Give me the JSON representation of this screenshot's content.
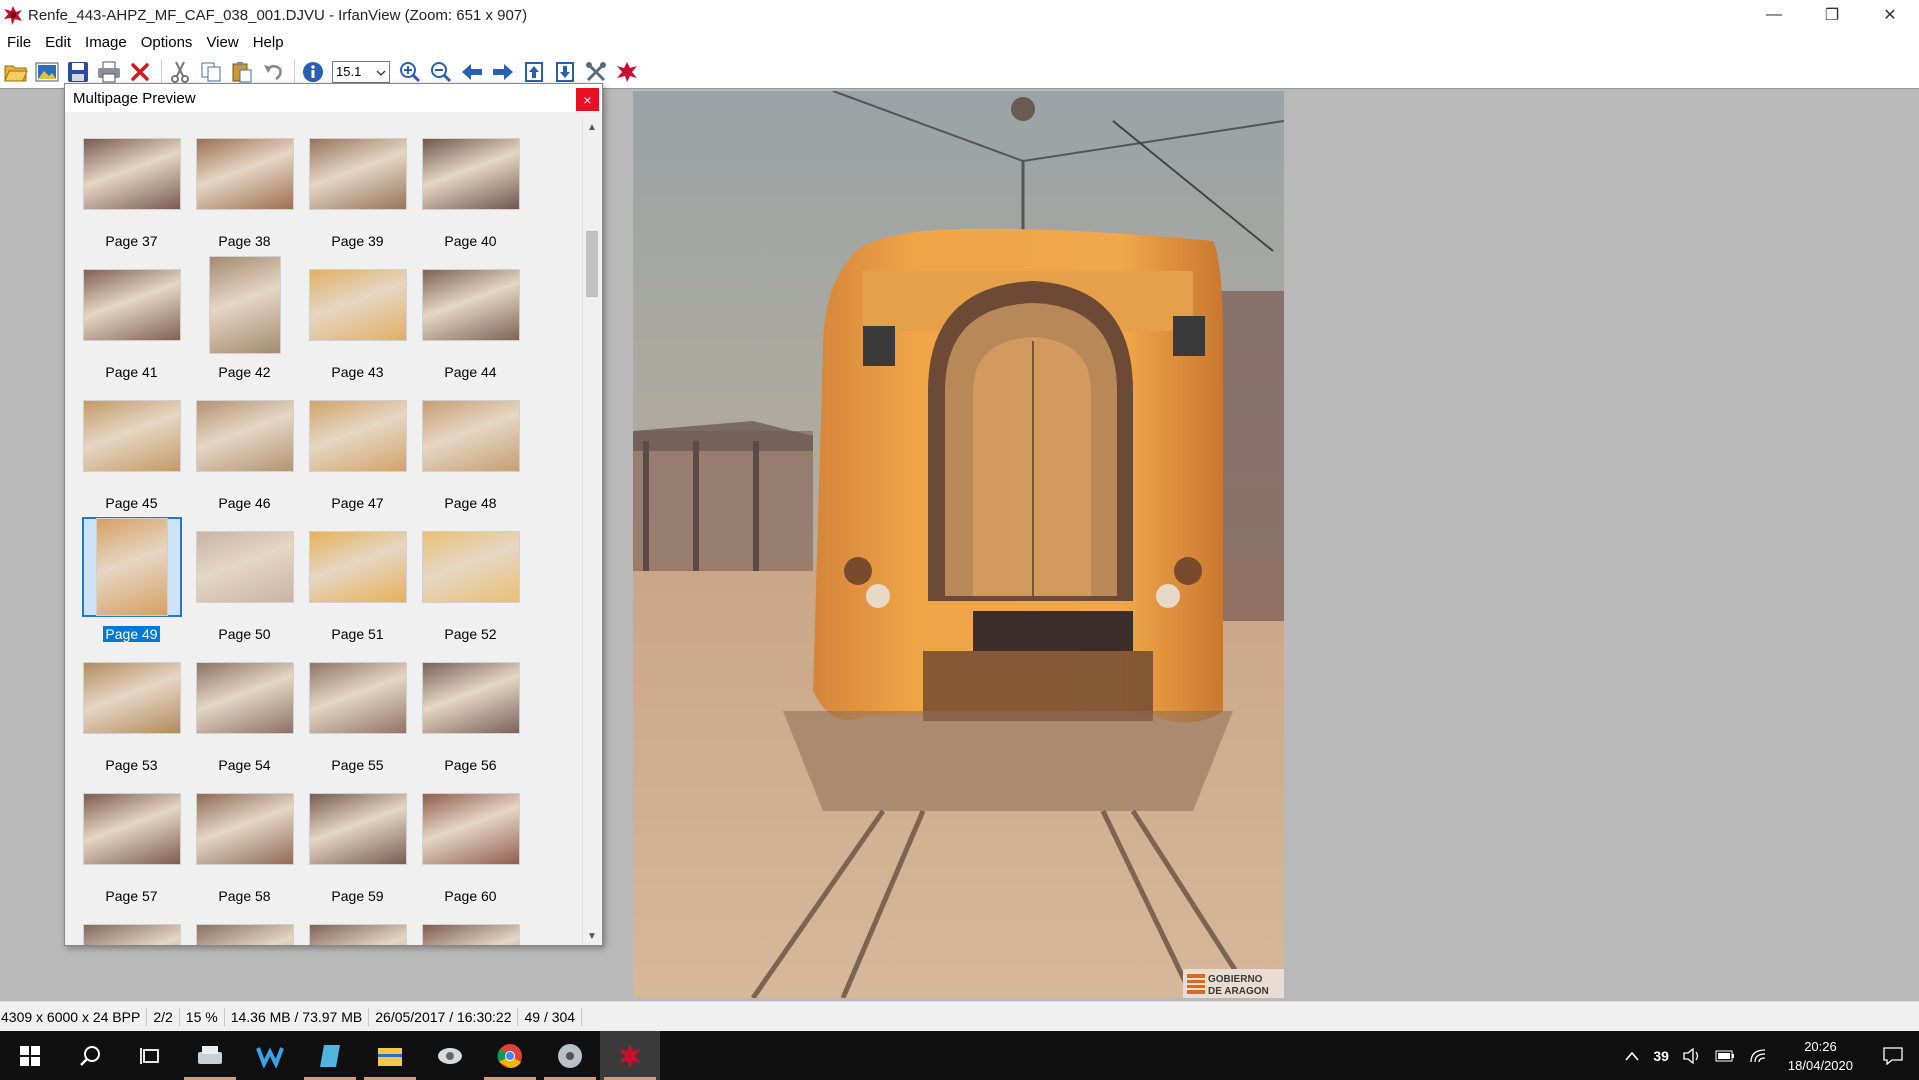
{
  "window": {
    "title": "Renfe_443-AHPZ_MF_CAF_038_001.DJVU - IrfanView (Zoom: 651 x 907)",
    "controls": {
      "minimize": "—",
      "restore": "❐",
      "close": "✕"
    }
  },
  "menu": [
    "File",
    "Edit",
    "Image",
    "Options",
    "View",
    "Help"
  ],
  "toolbar": {
    "zoom_value": "15.1",
    "icons": [
      "open-folder-icon",
      "thumbnails-icon",
      "save-icon",
      "print-icon",
      "delete-icon",
      "cut-icon",
      "copy-icon",
      "paste-icon",
      "undo-icon",
      "info-icon",
      "zoom-in-icon",
      "zoom-out-icon",
      "previous-icon",
      "next-icon",
      "page-prev-icon",
      "page-next-icon",
      "settings-icon",
      "about-icon"
    ]
  },
  "multipage": {
    "title": "Multipage Preview",
    "close": "×",
    "selected_page": 49,
    "pages": [
      {
        "label": "Page 37",
        "tone": "#7a5a50"
      },
      {
        "label": "Page 38",
        "tone": "#9c6f52"
      },
      {
        "label": "Page 39",
        "tone": "#96745a"
      },
      {
        "label": "Page 40",
        "tone": "#70574d"
      },
      {
        "label": "Page 41",
        "tone": "#806054"
      },
      {
        "label": "Page 42",
        "tone": "#a48a70"
      },
      {
        "label": "Page 43",
        "tone": "#e0b063"
      },
      {
        "label": "Page 44",
        "tone": "#7d6355"
      },
      {
        "label": "Page 45",
        "tone": "#c39a66"
      },
      {
        "label": "Page 46",
        "tone": "#b39374"
      },
      {
        "label": "Page 47",
        "tone": "#d1a469"
      },
      {
        "label": "Page 48",
        "tone": "#c59f73"
      },
      {
        "label": "Page 49",
        "tone": "#d6a062"
      },
      {
        "label": "Page 50",
        "tone": "#c9b3a5"
      },
      {
        "label": "Page 51",
        "tone": "#e6b158"
      },
      {
        "label": "Page 52",
        "tone": "#e9c173"
      },
      {
        "label": "Page 53",
        "tone": "#b28b5e"
      },
      {
        "label": "Page 54",
        "tone": "#8b7265"
      },
      {
        "label": "Page 55",
        "tone": "#8f7566"
      },
      {
        "label": "Page 56",
        "tone": "#7a6259"
      },
      {
        "label": "Page 57",
        "tone": "#7d5c4f"
      },
      {
        "label": "Page 58",
        "tone": "#8e6b57"
      },
      {
        "label": "Page 59",
        "tone": "#775c51"
      },
      {
        "label": "Page 60",
        "tone": "#905e4f"
      },
      {
        "label": "",
        "tone": "#826a5e"
      },
      {
        "label": "",
        "tone": "#8a7060"
      },
      {
        "label": "",
        "tone": "#806457"
      },
      {
        "label": "",
        "tone": "#7d5e52"
      }
    ]
  },
  "image": {
    "watermark_line1": "GOBIERNO",
    "watermark_line2": "DE ARAGON"
  },
  "status": {
    "dimensions": "4309 x 6000 x 24 BPP",
    "frame": "2/2",
    "zoom": "15 %",
    "memory": "14.36 MB / 73.97 MB",
    "date": "26/05/2017 / 16:30:22",
    "page": "49 / 304"
  },
  "taskbar": {
    "apps": [
      "start-icon",
      "search-icon",
      "task-view-icon",
      "scanner-app-icon",
      "wps-icon",
      "notepad-icon",
      "file-explorer-icon",
      "vpn-icon",
      "chrome-icon",
      "disc-app-icon",
      "irfanview-icon"
    ],
    "tray": {
      "temperature": "39",
      "time": "20:26",
      "date": "18/04/2020"
    }
  },
  "colors": {
    "selection": "#0078d7",
    "viewer_bg": "#b9b9b9",
    "close_red": "#e81123"
  }
}
